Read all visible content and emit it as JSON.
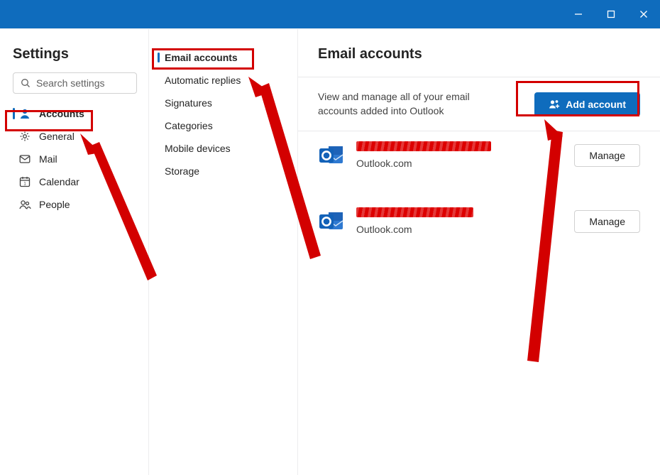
{
  "window": {
    "titlebar": {
      "color": "#0f6cbd"
    }
  },
  "sidebar": {
    "title": "Settings",
    "search_placeholder": "Search settings",
    "items": [
      {
        "label": "Accounts",
        "icon": "person-icon",
        "active": true
      },
      {
        "label": "General",
        "icon": "gear-icon"
      },
      {
        "label": "Mail",
        "icon": "mail-icon"
      },
      {
        "label": "Calendar",
        "icon": "calendar-icon"
      },
      {
        "label": "People",
        "icon": "people-icon"
      }
    ]
  },
  "subnav": {
    "items": [
      {
        "label": "Email accounts",
        "active": true
      },
      {
        "label": "Automatic replies"
      },
      {
        "label": "Signatures"
      },
      {
        "label": "Categories"
      },
      {
        "label": "Mobile devices"
      },
      {
        "label": "Storage"
      }
    ]
  },
  "main": {
    "title": "Email accounts",
    "description": "View and manage all of your email accounts added into Outlook",
    "add_button": "Add account",
    "manage_label": "Manage",
    "accounts": [
      {
        "email": "[redacted]",
        "provider": "Outlook.com"
      },
      {
        "email": "[redacted]",
        "provider": "Outlook.com"
      }
    ]
  },
  "annotations": {
    "highlights": [
      "sidebar-item-accounts",
      "subnav-item-email-accounts",
      "add-account-button"
    ]
  }
}
